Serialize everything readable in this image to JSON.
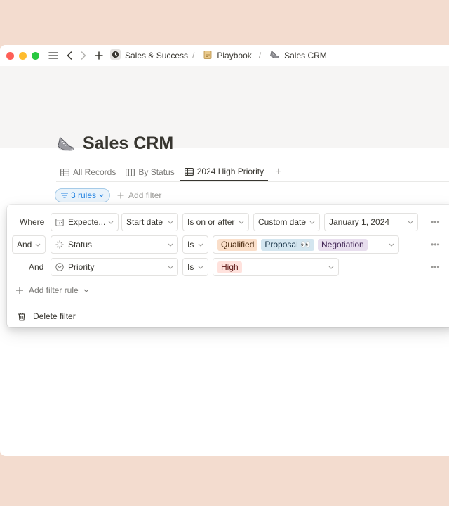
{
  "titlebar": {
    "breadcrumbs": [
      {
        "label": "Sales & Success",
        "icon": "clock-icon"
      },
      {
        "label": "Playbook",
        "icon": "scroll-icon"
      },
      {
        "label": "Sales CRM",
        "icon": "shoe-icon"
      }
    ],
    "separator": "/"
  },
  "page": {
    "title": "Sales CRM",
    "icon": "shoe-icon"
  },
  "tabs": [
    {
      "label": "All Records",
      "icon": "table-icon",
      "active": false
    },
    {
      "label": "By Status",
      "icon": "board-icon",
      "active": false
    },
    {
      "label": "2024 High Priority",
      "icon": "table-icon",
      "active": true
    }
  ],
  "filter_bar": {
    "rules_label": "3 rules",
    "add_filter_label": "Add filter"
  },
  "filter_panel": {
    "rows": [
      {
        "conjunction": "Where",
        "property": "Expecte...",
        "property_icon": "calendar-icon",
        "extra": "Start date",
        "operator": "Is on or after",
        "value_type": "Custom date",
        "value": "January 1, 2024"
      },
      {
        "conjunction": "And",
        "property": "Status",
        "property_icon": "status-icon",
        "operator": "Is",
        "tags": [
          {
            "label": "Qualified",
            "bg": "#fadec9",
            "fg": "#49290e"
          },
          {
            "label": "Proposal 👀",
            "bg": "#d3e5ef",
            "fg": "#183347"
          },
          {
            "label": "Negotiation",
            "bg": "#e8deee",
            "fg": "#412454"
          }
        ]
      },
      {
        "conjunction": "And",
        "property": "Priority",
        "property_icon": "select-icon",
        "operator": "Is",
        "tags": [
          {
            "label": "High",
            "bg": "#ffe2dd",
            "fg": "#5d1715"
          }
        ]
      }
    ],
    "add_rule_label": "Add filter rule",
    "delete_label": "Delete filter"
  },
  "colors": {
    "background": "#f3dccf",
    "accent": "#2383e2",
    "cover": "#f6f5f4"
  }
}
